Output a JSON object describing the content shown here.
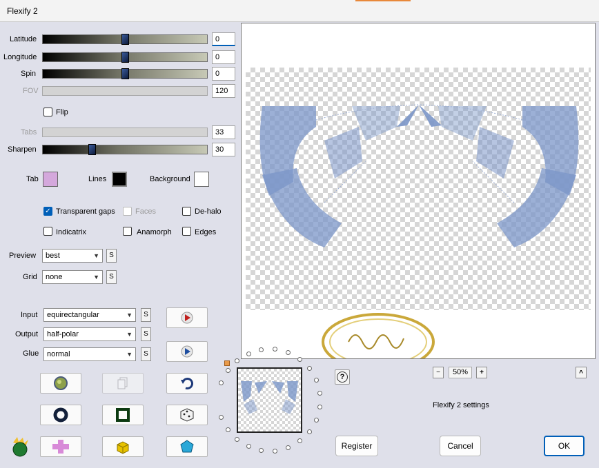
{
  "window": {
    "title": "Flexify 2"
  },
  "sliders": [
    {
      "label": "Latitude",
      "value": "0",
      "fraction": 0.5,
      "disabled": false
    },
    {
      "label": "Longitude",
      "value": "0",
      "fraction": 0.5,
      "disabled": false
    },
    {
      "label": "Spin",
      "value": "0",
      "fraction": 0.5,
      "disabled": false
    },
    {
      "label": "FOV",
      "value": "120",
      "fraction": 0.0,
      "disabled": true
    },
    {
      "label": "Tabs",
      "value": "33",
      "fraction": 0.0,
      "disabled": true
    },
    {
      "label": "Sharpen",
      "value": "30",
      "fraction": 0.3,
      "disabled": false
    }
  ],
  "flip": {
    "label": "Flip",
    "checked": false
  },
  "colors": {
    "tab": {
      "label": "Tab",
      "color": "#d4a8dc"
    },
    "lines": {
      "label": "Lines",
      "color": "#000000"
    },
    "background": {
      "label": "Background",
      "color": "#ffffff"
    }
  },
  "options": {
    "transparent_gaps": {
      "label": "Transparent gaps",
      "checked": true
    },
    "faces": {
      "label": "Faces",
      "checked": false,
      "disabled": true
    },
    "de_halo": {
      "label": "De-halo",
      "checked": false
    },
    "indicatrix": {
      "label": "Indicatrix",
      "checked": false
    },
    "anamorph": {
      "label": "Anamorph",
      "checked": false
    },
    "edges": {
      "label": "Edges",
      "checked": false
    }
  },
  "preview_select": {
    "label": "Preview",
    "value": "best",
    "s": "S"
  },
  "grid_select": {
    "label": "Grid",
    "value": "none",
    "s": "S"
  },
  "input_select": {
    "label": "Input",
    "value": "equirectangular",
    "s": "S"
  },
  "output_select": {
    "label": "Output",
    "value": "half-polar",
    "s": "S"
  },
  "glue_select": {
    "label": "Glue",
    "value": "normal",
    "s": "S"
  },
  "zoom": {
    "minus": "−",
    "value": "50%",
    "plus": "+",
    "collapse": "^"
  },
  "help": {
    "label": "?"
  },
  "settings_text": "Flexify 2 settings",
  "buttons": {
    "register": "Register",
    "cancel": "Cancel",
    "ok": "OK"
  },
  "accent_color": "#7b96c8"
}
